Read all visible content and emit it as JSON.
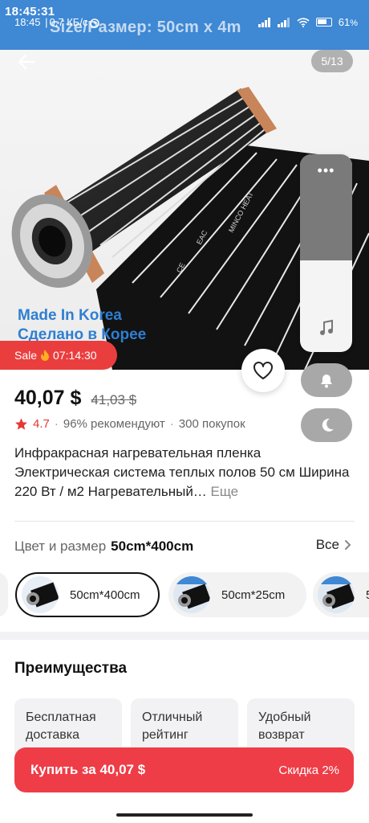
{
  "status_bar": {
    "overlay_time": "18:45:31",
    "time": "18:45",
    "speed": "0,7 КБ/с",
    "battery": "61",
    "battery_unit": "%"
  },
  "hero": {
    "banner_text": "Size/Размер:  50cm x 4m",
    "counter": "5/13",
    "made_in_en": "Made In Korea",
    "made_in_ru": "Сделано в Корее",
    "sale_label": "Sale",
    "sale_timer": "07:14:30",
    "float_dots": "•••"
  },
  "product": {
    "price": "40,07 $",
    "old_price": "41,03 $",
    "rating": "4.7",
    "recommend": "96% рекомендуют",
    "purchases": "300 покупок",
    "title": "Инфракрасная нагревательная пленка Электрическая система теплых полов 50 см Ширина 220 Вт / м2 Нагревательный…",
    "more": "Еще"
  },
  "variant": {
    "label": "Цвет и размер",
    "selected_value": "50cm*400cm",
    "all_label": "Все",
    "chips": [
      {
        "label": "50cm*400cm",
        "selected": true
      },
      {
        "label": "50cm*25cm",
        "selected": false
      },
      {
        "label": "5",
        "selected": false
      }
    ]
  },
  "benefits": {
    "title": "Преимущества",
    "cards": [
      {
        "label": "Бесплатная доставка"
      },
      {
        "label": "Отличный рейтинг"
      },
      {
        "label": "Удобный возврат"
      }
    ]
  },
  "buy_bar": {
    "label": "Купить за 40,07 $",
    "discount": "Скидка 2%"
  },
  "colors": {
    "accent_red": "#ee3d47",
    "sale_red": "#ea3e3e",
    "made_in_blue": "#2e7fd2",
    "banner_blue": "#3e88d4"
  },
  "icons": [
    "back-arrow-icon",
    "heart-icon",
    "bell-icon",
    "moon-icon",
    "music-note-icon",
    "chevron-right-icon",
    "star-icon",
    "fire-icon",
    "wifi-icon",
    "signal-icon",
    "alarm-icon"
  ]
}
